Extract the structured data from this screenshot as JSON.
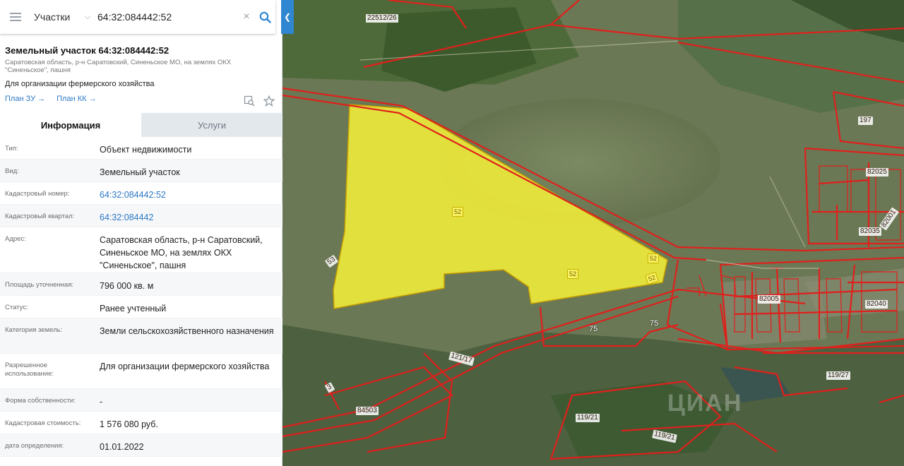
{
  "search": {
    "category": "Участки",
    "query": "64:32:084442:52"
  },
  "parcel": {
    "title": "Земельный участок 64:32:084442:52",
    "address_short": "Саратовская область, р-н Саратовский, Синеньское МО, на землях ОКХ \"Синеньское\", пашня",
    "usage": "Для организации фермерского хозяйства",
    "links": [
      "План ЗУ →",
      "План КК →"
    ]
  },
  "tabs": [
    {
      "label": "Информация",
      "active": true
    },
    {
      "label": "Услуги",
      "active": false
    }
  ],
  "info_rows": [
    {
      "key": "Тип:",
      "value": "Объект недвижимости",
      "link": false
    },
    {
      "key": "Вид:",
      "value": "Земельный участок",
      "link": false
    },
    {
      "key": "Кадастровый номер:",
      "value": "64:32:084442:52",
      "link": true
    },
    {
      "key": "Кадастровый квартал:",
      "value": "64:32:084442",
      "link": true
    },
    {
      "key": "Адрес:",
      "value": "Саратовская область, р-н Саратовский, Синеньское МО, на землях ОКХ \"Синеньское\", пашня",
      "link": false
    },
    {
      "key": "Площадь уточненная:",
      "value": "796 000 кв. м",
      "link": false
    },
    {
      "key": "Статус:",
      "value": "Ранее учтенный",
      "link": false
    },
    {
      "key": "Категория земель:",
      "value": "Земли сельскохозяйственного назначения",
      "link": false
    },
    {
      "key": "Разрешенное использование:",
      "value": "Для организации фермерского хозяйства",
      "link": false
    },
    {
      "key": "Форма собственности:",
      "value": "-",
      "link": false
    },
    {
      "key": "Кадастровая стоимость:",
      "value": "1 576 080 руб.",
      "link": false
    },
    {
      "key": "дата определения:",
      "value": "01.01.2022",
      "link": false
    }
  ],
  "map": {
    "labels": [
      "22512/26",
      "197",
      "82025",
      "82001",
      "82035",
      "52",
      "52",
      "52",
      "52",
      "53",
      "75",
      "75",
      "82005",
      "82040",
      "121/17",
      "84503",
      "119/21",
      "119/21",
      "119/27",
      "3"
    ],
    "watermark": "ЦИАН",
    "boundary_color": "#e0201c",
    "selected_fill": "#f2ee3a"
  }
}
